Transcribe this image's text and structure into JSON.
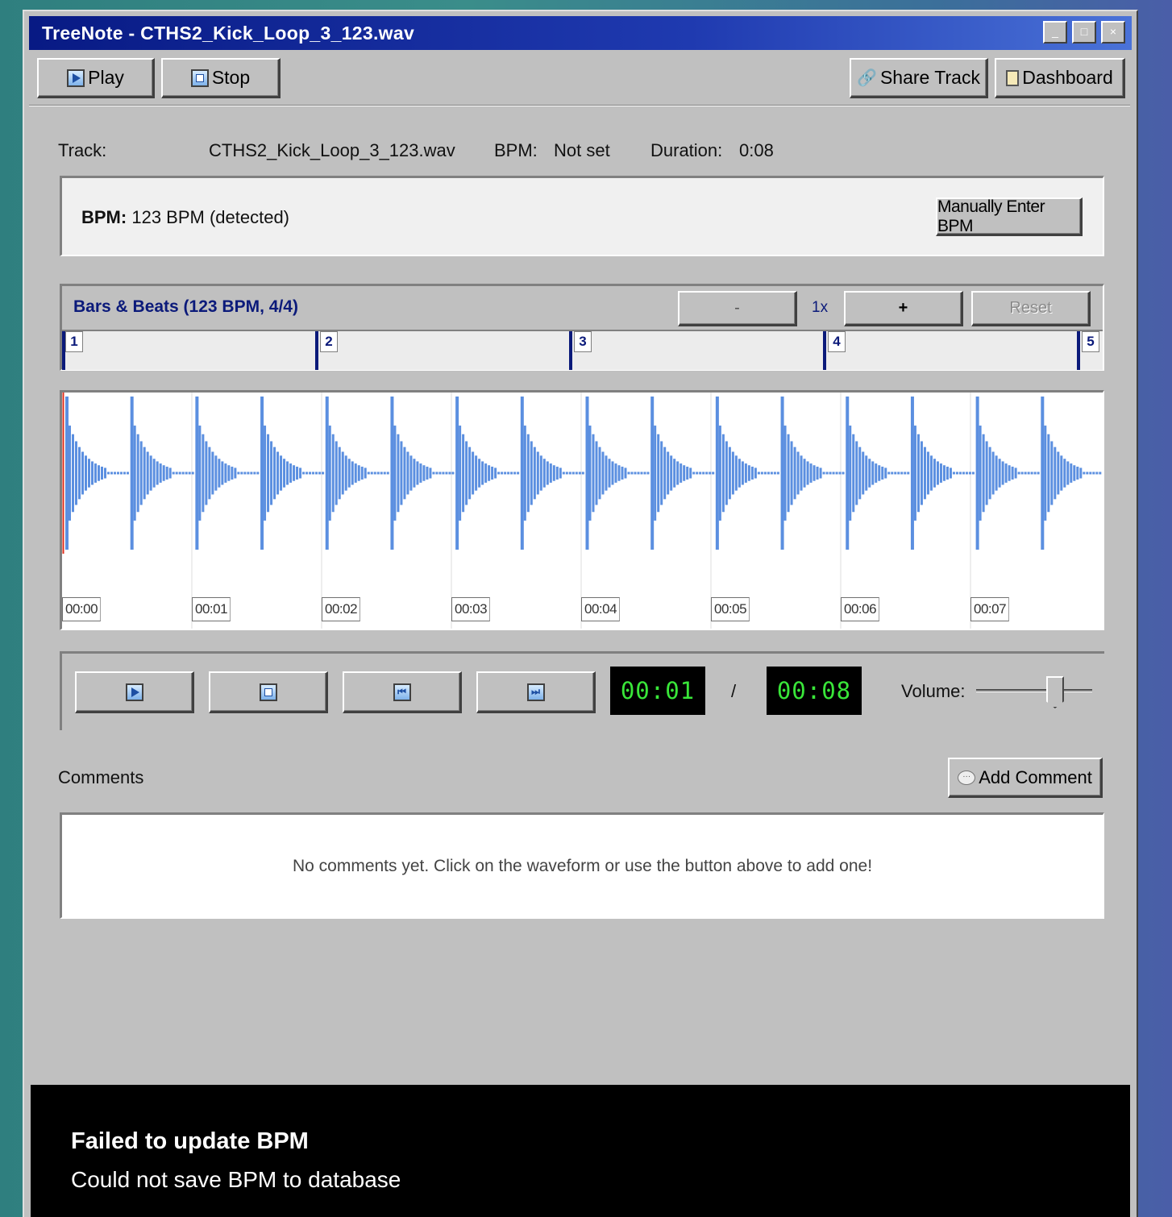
{
  "window": {
    "title": "TreeNote - CTHS2_Kick_Loop_3_123.wav",
    "controls": {
      "minimize": "_",
      "maximize": "□",
      "close": "×"
    }
  },
  "toolbar": {
    "play_label": "Play",
    "stop_label": "Stop",
    "share_label": "Share Track",
    "dashboard_label": "Dashboard"
  },
  "track_info": {
    "track_label": "Track:",
    "track_value": "CTHS2_Kick_Loop_3_123.wav",
    "bpm_label": "BPM:",
    "bpm_value": "Not set",
    "duration_label": "Duration:",
    "duration_value": "0:08"
  },
  "bpm_panel": {
    "label": "BPM:",
    "value": "123 BPM (detected)",
    "manual_button": "Manually Enter BPM"
  },
  "bars_beats": {
    "title": "Bars & Beats (123 BPM, 4/4)",
    "zoom_out": "-",
    "zoom_level": "1x",
    "zoom_in": "+",
    "reset": "Reset",
    "bars": [
      "1",
      "2",
      "3",
      "4",
      "5"
    ]
  },
  "waveform": {
    "color": "#5b8fe0",
    "playhead_color": "#e0301e",
    "timestamps": [
      "00:00",
      "00:01",
      "00:02",
      "00:03",
      "00:04",
      "00:05",
      "00:06",
      "00:07"
    ]
  },
  "transport": {
    "current_time": "00:01",
    "separator": "/",
    "total_time": "00:08",
    "volume_label": "Volume:",
    "volume_level": 0.68
  },
  "comments": {
    "title": "Comments",
    "add_button": "Add Comment",
    "empty_message": "No comments yet. Click on the waveform or use the button above to add one!"
  },
  "toast": {
    "title": "Failed to update BPM",
    "message": "Could not save BPM to database"
  },
  "colors": {
    "titlebar_start": "#081a84",
    "titlebar_end": "#4a72d8",
    "lcd_text": "#39e639",
    "accent_text": "#0b1a7a"
  }
}
